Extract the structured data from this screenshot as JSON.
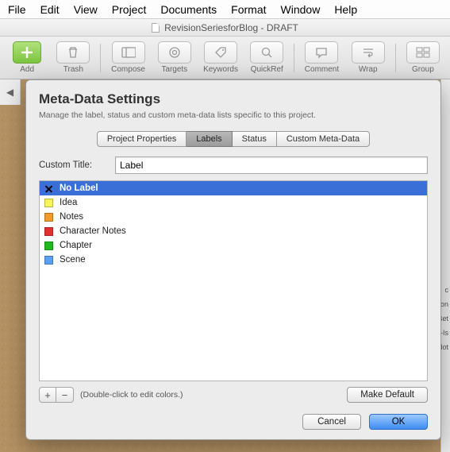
{
  "menu": [
    "File",
    "Edit",
    "View",
    "Project",
    "Documents",
    "Format",
    "Window",
    "Help"
  ],
  "window_title": "RevisionSeriesforBlog - DRAFT",
  "toolbar": [
    {
      "label": "Add",
      "icon": "plus",
      "green": true
    },
    {
      "label": "Trash",
      "icon": "trash"
    },
    {
      "sep": true
    },
    {
      "label": "Compose",
      "icon": "compose"
    },
    {
      "label": "Targets",
      "icon": "targets"
    },
    {
      "label": "Keywords",
      "icon": "keywords"
    },
    {
      "label": "QuickRef",
      "icon": "quickref"
    },
    {
      "sep": true
    },
    {
      "label": "Comment",
      "icon": "comment"
    },
    {
      "label": "Wrap",
      "icon": "wrap"
    },
    {
      "sep": true
    },
    {
      "label": "Group",
      "icon": "group"
    }
  ],
  "nav_back": "◀",
  "right_peek": [
    "c",
    "on",
    "Bet",
    "-Is",
    "Not"
  ],
  "modal": {
    "title": "Meta-Data Settings",
    "subtitle": "Manage the label, status and custom meta-data lists specific to this project.",
    "tabs": [
      "Project Properties",
      "Labels",
      "Status",
      "Custom Meta-Data"
    ],
    "active_tab": 1,
    "custom_title_label": "Custom Title:",
    "custom_title_value": "Label",
    "labels": [
      {
        "name": "No Label",
        "color": null,
        "selected": true
      },
      {
        "name": "Idea",
        "color": "#f7f35a"
      },
      {
        "name": "Notes",
        "color": "#f19a2a"
      },
      {
        "name": "Character Notes",
        "color": "#e03030"
      },
      {
        "name": "Chapter",
        "color": "#1fb81f"
      },
      {
        "name": "Scene",
        "color": "#5a9ff0"
      }
    ],
    "add_btn": "+",
    "remove_btn": "−",
    "hint": "(Double-click to edit colors.)",
    "make_default": "Make Default",
    "cancel": "Cancel",
    "ok": "OK"
  }
}
